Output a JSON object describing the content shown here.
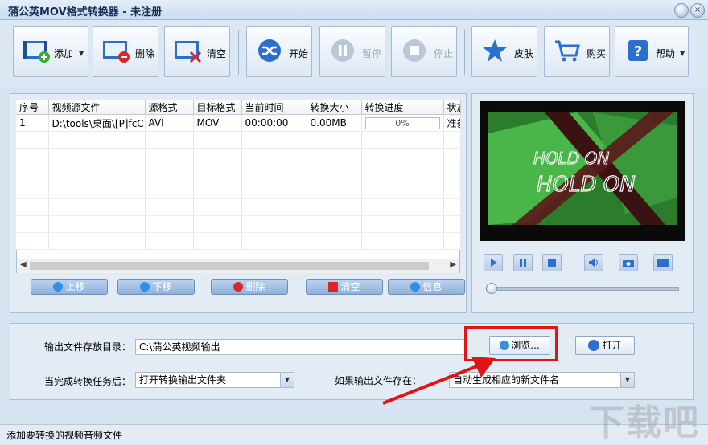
{
  "window": {
    "title": "蒲公英MOV格式转换器 - 未注册",
    "minimize": "–",
    "close": "×"
  },
  "toolbar": {
    "add": "添加",
    "delete": "删除",
    "clear": "清空",
    "start": "开始",
    "pause": "暂停",
    "stop": "停止",
    "skin": "皮肤",
    "buy": "购买",
    "help": "帮助"
  },
  "table": {
    "headers": [
      "序号",
      "视频源文件",
      "源格式",
      "目标格式",
      "当前时间",
      "转换大小",
      "转换进度",
      "状态"
    ],
    "rows": [
      {
        "index": "1",
        "source": "D:\\tools\\桌面\\[P]fcC...",
        "src_format": "AVI",
        "dst_format": "MOV",
        "time": "00:00:00",
        "size": "0.00MB",
        "progress": "0%",
        "status": "准备"
      }
    ]
  },
  "list_buttons": {
    "up": "上移",
    "down": "下移",
    "delete": "删除",
    "clear": "清空",
    "info": "信息"
  },
  "output": {
    "dir_label": "输出文件存放目录：",
    "dir_value": "C:\\蒲公英视频输出",
    "browse": "浏览...",
    "open": "打开",
    "after_label": "当完成转换任务后：",
    "after_value": "打开转换输出文件夹",
    "exist_label": "如果输出文件存在：",
    "exist_value": "自动生成相应的新文件名"
  },
  "preview": {
    "overlay_text": "HOLD ON"
  },
  "status": {
    "text": "添加要转换的视频音频文件"
  },
  "watermark": "下载吧",
  "colors": {
    "accent": "#2b6fcf",
    "highlight": "#e01414"
  }
}
